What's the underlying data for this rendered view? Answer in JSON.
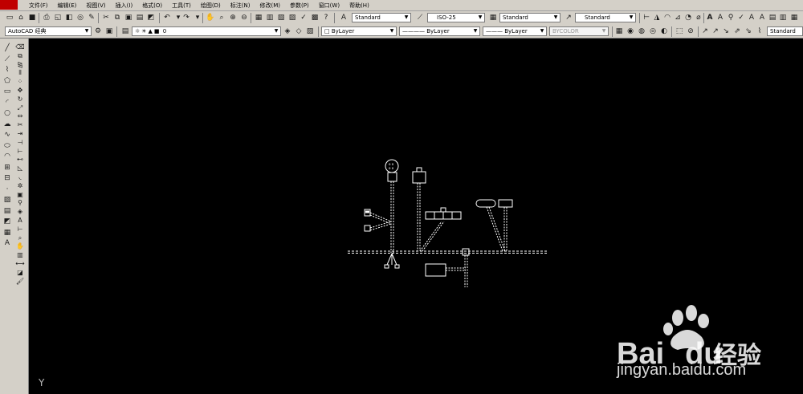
{
  "menu": [
    "文件(F)",
    "编辑(E)",
    "视图(V)",
    "插入(I)",
    "格式(O)",
    "工具(T)",
    "绘图(D)",
    "标注(N)",
    "修改(M)",
    "参数(P)",
    "窗口(W)",
    "帮助(H)"
  ],
  "toolbar1": {
    "text_style": "Standard",
    "dim_style": "ISO-25",
    "table_style": "Standard",
    "multileader_style": "Standard"
  },
  "toolbar2": {
    "workspace": "AutoCAD 经典",
    "layer": "0",
    "color": "ByLayer",
    "linetype": "ByLayer",
    "lineweight": "ByLayer",
    "plotstyle": "BYCOLOR",
    "named_view": "Standard"
  },
  "ucs_label": "Y",
  "watermark": {
    "brand": "Bai",
    "brand2": "du",
    "cn": "经验",
    "url": "jingyan.baidu.com"
  },
  "colors": {
    "canvas": "#000000",
    "toolbar": "#d4d0c8",
    "drawing": "#ffffff"
  }
}
